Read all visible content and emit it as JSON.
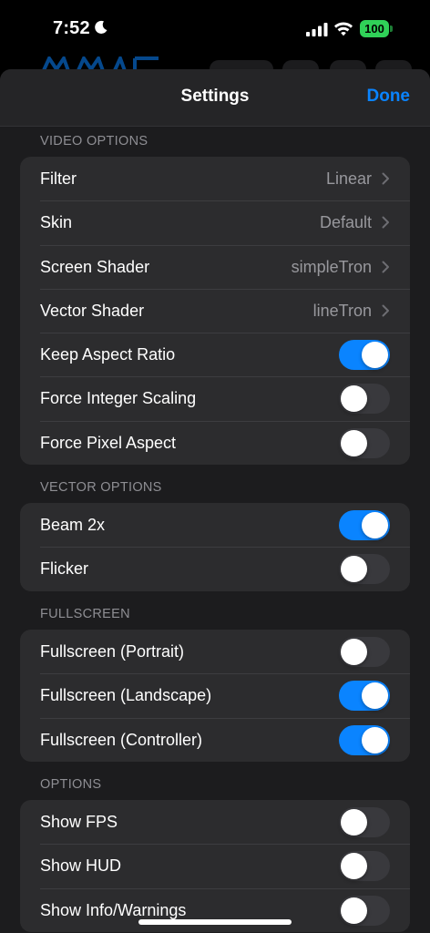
{
  "status_bar": {
    "time": "7:52",
    "battery": "100"
  },
  "nav": {
    "title": "Settings",
    "done_label": "Done"
  },
  "sections": [
    {
      "header": "VIDEO OPTIONS",
      "rows": [
        {
          "label": "Filter",
          "value": "Linear",
          "type": "disclosure"
        },
        {
          "label": "Skin",
          "value": "Default",
          "type": "disclosure"
        },
        {
          "label": "Screen Shader",
          "value": "simpleTron",
          "type": "disclosure"
        },
        {
          "label": "Vector Shader",
          "value": "lineTron",
          "type": "disclosure"
        },
        {
          "label": "Keep Aspect Ratio",
          "type": "toggle",
          "on": true
        },
        {
          "label": "Force Integer Scaling",
          "type": "toggle",
          "on": false
        },
        {
          "label": "Force Pixel Aspect",
          "type": "toggle",
          "on": false
        }
      ]
    },
    {
      "header": "VECTOR OPTIONS",
      "rows": [
        {
          "label": "Beam 2x",
          "type": "toggle",
          "on": true
        },
        {
          "label": "Flicker",
          "type": "toggle",
          "on": false
        }
      ]
    },
    {
      "header": "FULLSCREEN",
      "rows": [
        {
          "label": "Fullscreen (Portrait)",
          "type": "toggle",
          "on": false
        },
        {
          "label": "Fullscreen (Landscape)",
          "type": "toggle",
          "on": true
        },
        {
          "label": "Fullscreen (Controller)",
          "type": "toggle",
          "on": true
        }
      ]
    },
    {
      "header": "OPTIONS",
      "rows": [
        {
          "label": "Show FPS",
          "type": "toggle",
          "on": false
        },
        {
          "label": "Show HUD",
          "type": "toggle",
          "on": false
        },
        {
          "label": "Show Info/Warnings",
          "type": "toggle",
          "on": false
        }
      ]
    }
  ],
  "colors": {
    "accent": "#0a84ff",
    "battery": "#30d158",
    "toggle_off": "#39393d"
  }
}
